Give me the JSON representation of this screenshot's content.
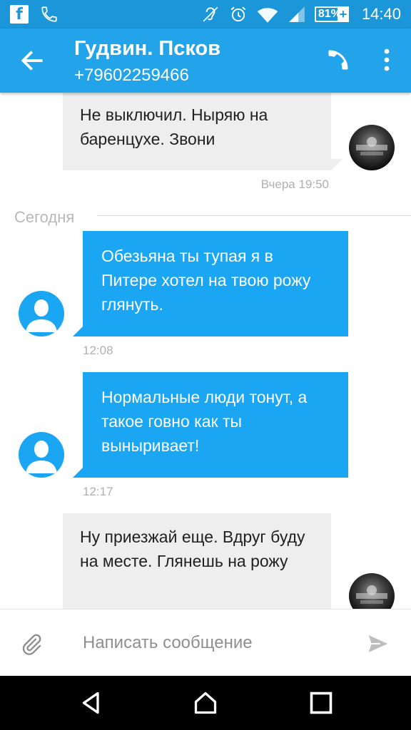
{
  "status_bar": {
    "battery": "81%",
    "time": "14:40",
    "icons": [
      "facebook-icon",
      "phone-icon",
      "hearing-aid-icon",
      "alarm-icon",
      "wifi-icon",
      "signal-icon",
      "battery-icon"
    ]
  },
  "header": {
    "title": "Гудвин. Псков",
    "phone": "+79602259466"
  },
  "chat": {
    "messages": [
      {
        "direction": "incoming",
        "text": "Не выключил. Ныряю на баренцухе. Звони",
        "time": "Вчера 19:50"
      },
      {
        "direction": "outgoing",
        "text": "Обезьяна ты тупая я в Питере хотел на твою рожу глянуть.",
        "time": "12:08"
      },
      {
        "direction": "outgoing",
        "text": "Нормальные люди тонут, а такое говно как ты выныривает!",
        "time": "12:17"
      },
      {
        "direction": "incoming",
        "text": "Ну приезжай еще. Вдруг буду на месте. Глянешь на рожу",
        "time": ""
      }
    ],
    "date_separator": "Сегодня"
  },
  "composer": {
    "placeholder": "Написать сообщение",
    "value": ""
  },
  "colors": {
    "status_bar": "#1b96d9",
    "toolbar": "#22a3ea",
    "outgoing_bubble": "#1aa6f2",
    "incoming_bubble": "#eeeeee",
    "nav_bar": "#000000"
  }
}
